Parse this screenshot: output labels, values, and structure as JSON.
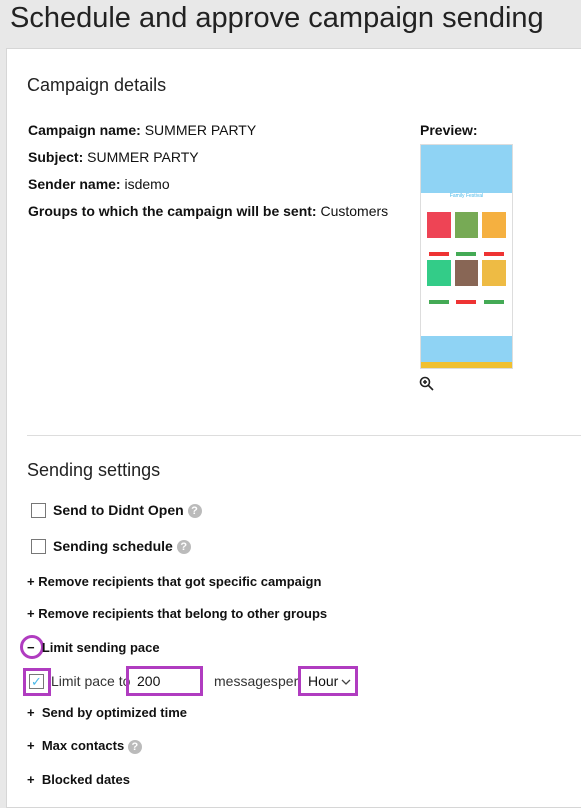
{
  "page": {
    "title": "Schedule and approve campaign sending"
  },
  "details": {
    "heading": "Campaign details",
    "campaign_name_label": "Campaign name:",
    "campaign_name": "SUMMER PARTY",
    "subject_label": "Subject:",
    "subject": "SUMMER PARTY",
    "sender_label": "Sender name:",
    "sender": "isdemo",
    "groups_label": "Groups to which the campaign will be sent:",
    "groups": "Customers",
    "preview_label": "Preview:",
    "preview_title": "Family Festival",
    "zoom_icon": "zoom-in-icon"
  },
  "sending": {
    "heading": "Sending settings",
    "didnt_open": "Send to Didnt Open",
    "schedule": "Sending schedule",
    "remove_campaign": "Remove recipients that got specific campaign",
    "remove_groups": "Remove recipients that belong to other groups",
    "limit_pace": "Limit sending pace",
    "limit_pace_to": "Limit pace to",
    "pace_value": "200",
    "messages": "messages",
    "per": "per",
    "unit": "Hour",
    "optimized": "Send by optimized time",
    "max_contacts": "Max contacts",
    "blocked": "Blocked dates",
    "help": "?",
    "plus": "+",
    "minus": "−",
    "highlight_color": "#b03cc0",
    "check_color": "#4ab8e8"
  }
}
